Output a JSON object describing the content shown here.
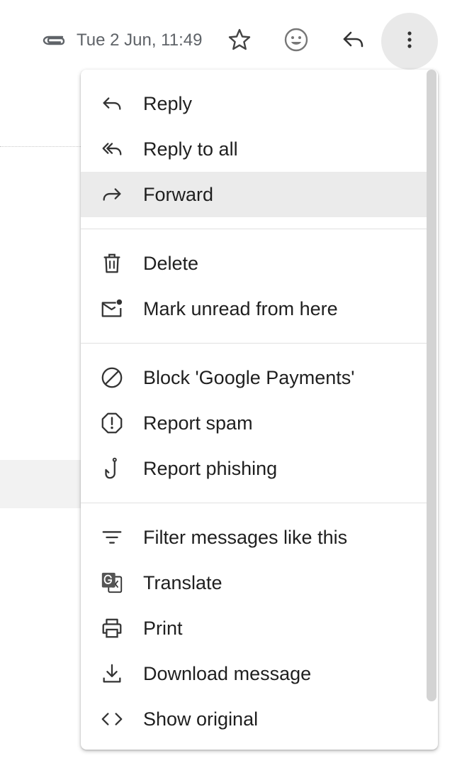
{
  "header": {
    "date": "Tue 2 Jun, 11:49",
    "icons": {
      "attachment": "paperclip-icon",
      "star": "star-icon",
      "emoji": "emoji-icon",
      "reply": "reply-icon",
      "more": "more-vert-icon"
    }
  },
  "menu": {
    "items": [
      {
        "label": "Reply",
        "icon": "reply-icon"
      },
      {
        "label": "Reply to all",
        "icon": "reply-all-icon"
      },
      {
        "label": "Forward",
        "icon": "forward-icon"
      },
      {
        "label": "Delete",
        "icon": "trash-icon"
      },
      {
        "label": "Mark unread from here",
        "icon": "mark-unread-icon"
      },
      {
        "label": "Block 'Google Payments'",
        "icon": "block-icon"
      },
      {
        "label": "Report spam",
        "icon": "report-spam-icon"
      },
      {
        "label": "Report phishing",
        "icon": "phishing-hook-icon"
      },
      {
        "label": "Filter messages like this",
        "icon": "filter-icon"
      },
      {
        "label": "Translate",
        "icon": "translate-icon"
      },
      {
        "label": "Print",
        "icon": "print-icon"
      },
      {
        "label": "Download message",
        "icon": "download-icon"
      },
      {
        "label": "Show original",
        "icon": "code-icon"
      }
    ],
    "highlighted_item": "Forward"
  },
  "colors": {
    "text": "#1f1f1f",
    "secondary_text": "#5f6368",
    "highlight": "#ebebeb",
    "more_button_bg": "#e9e9e9",
    "scrollbar": "#d3d3d3"
  }
}
